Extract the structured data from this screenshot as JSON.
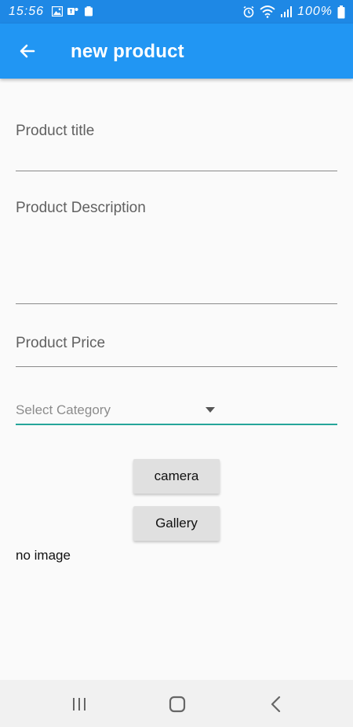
{
  "status_bar": {
    "time": "15:56",
    "battery": "100%",
    "left_icons": [
      "image-icon",
      "teams-icon",
      "battery-saver-icon"
    ],
    "right_icons": [
      "alarm-icon",
      "wifi-icon",
      "signal-icon",
      "battery-icon"
    ]
  },
  "app_bar": {
    "title": "new product",
    "back_icon": "arrow-back-icon",
    "color": "#2196f3"
  },
  "form": {
    "title_label": "Product title",
    "description_label": "Product Description",
    "price_label": "Product Price",
    "category_placeholder": "Select Category",
    "accent_color": "#26a69a"
  },
  "buttons": {
    "camera": "camera",
    "gallery": "Gallery"
  },
  "image_status": "no image",
  "nav_bar": {
    "icons": [
      "recent-apps-icon",
      "home-icon",
      "back-icon"
    ]
  }
}
